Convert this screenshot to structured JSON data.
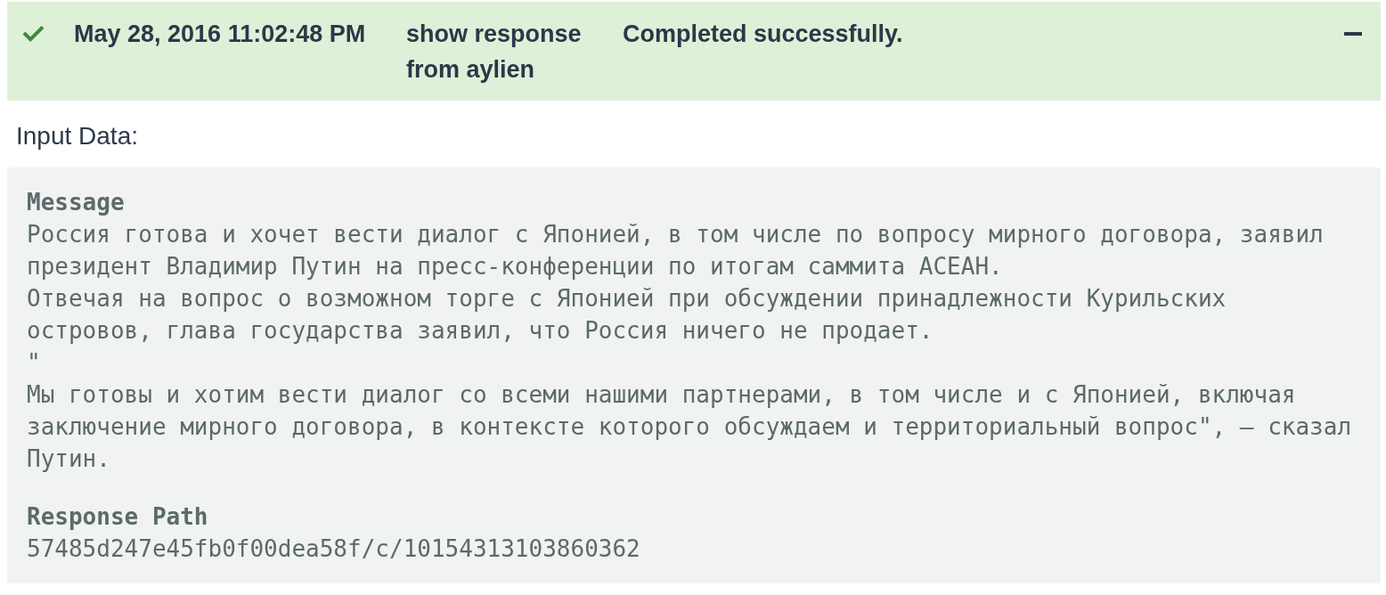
{
  "entry": {
    "succeeded": true,
    "timestamp": "May 28, 2016 11:02:48 PM",
    "step": "show response from aylien",
    "result": "Completed successfully.",
    "expanded": true
  },
  "input_data": {
    "title": "Input Data:",
    "fields": [
      {
        "label": "Message",
        "value": "Россия готова и хочет вести диалог с Японией, в том числе по вопросу мирного договора, заявил президент Владимир Путин на пресс-конференции по итогам саммита АСЕАН.\nОтвечая на вопрос о возможном торге с Японией при обсуждении принадлежности Курильских островов, глава государства заявил, что Россия ничего не продает.\n\"\nМы готовы и хотим вести диалог со всеми нашими партнерами, в том числе и с Японией, включая заключение мирного договора, в контексте которого обсуждаем и территориальный вопрос\", — сказал Путин."
      },
      {
        "label": "Response Path",
        "value": "57485d247e45fb0f00dea58f/c/10154313103860362"
      }
    ]
  }
}
